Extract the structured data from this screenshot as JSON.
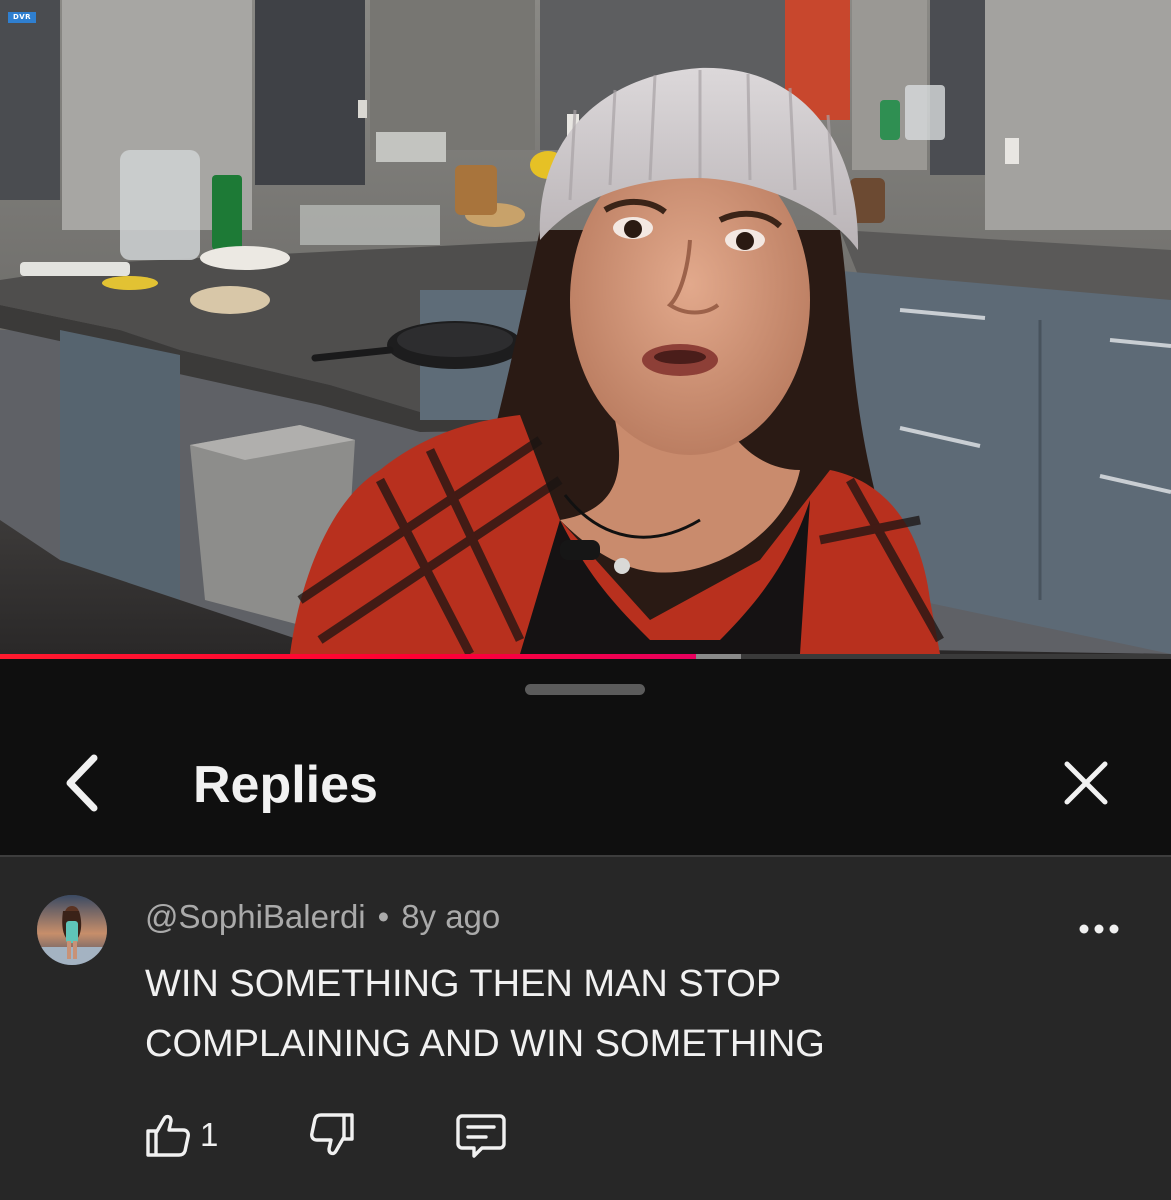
{
  "video": {
    "badge": "DVR",
    "progress": {
      "played_fraction": 0.594,
      "buffered_fraction": 0.633
    }
  },
  "sheet": {
    "title": "Replies",
    "back_icon": "chevron-left-icon",
    "close_icon": "close-icon"
  },
  "comment": {
    "author": "@SophiBalerdi",
    "separator": "•",
    "time": "8y ago",
    "text": "WIN SOMETHING THEN MAN STOP\nCOMPLAINING AND WIN SOMETHING",
    "like_count": "1",
    "icons": [
      "thumbs-up-icon",
      "thumbs-down-icon",
      "reply-icon",
      "more-options-icon"
    ]
  },
  "colors": {
    "background": "#0f0f0f",
    "comment_background": "#272727",
    "text_primary": "#f1f1f1",
    "text_secondary": "#aaaaaa",
    "progress_red": "#ff0033"
  }
}
